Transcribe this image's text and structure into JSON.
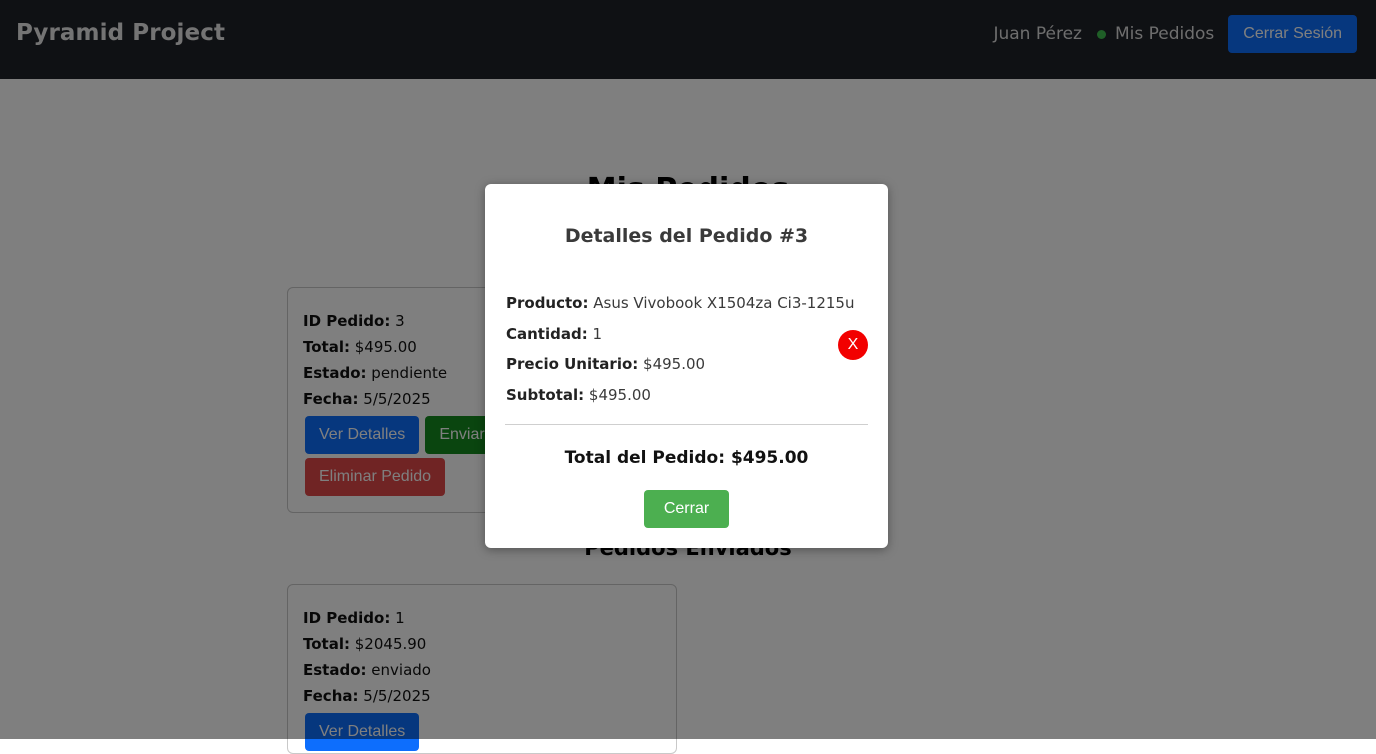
{
  "navbar": {
    "brand": "Pyramid Project",
    "user_name": "Juan Pérez",
    "nav_link": "Mis Pedidos",
    "logout_label": "Cerrar Sesión"
  },
  "page": {
    "title": "Mis Pedidos",
    "sent_section_title": "Pedidos Enviados"
  },
  "pending_order": {
    "id_label": "ID Pedido:",
    "id": "3",
    "total_label": "Total:",
    "total": "$495.00",
    "estado_label": "Estado:",
    "estado": "pendiente",
    "fecha_label": "Fecha:",
    "fecha": "5/5/2025",
    "btn_details": "Ver Detalles",
    "btn_send": "Enviar Pedido",
    "btn_delete": "Eliminar Pedido"
  },
  "sent_order": {
    "id_label": "ID Pedido:",
    "id": "1",
    "total_label": "Total:",
    "total": "$2045.90",
    "estado_label": "Estado:",
    "estado": "enviado",
    "fecha_label": "Fecha:",
    "fecha": "5/5/2025",
    "btn_details": "Ver Detalles"
  },
  "modal": {
    "title": "Detalles del Pedido #3",
    "producto_label": "Producto:",
    "producto": "Asus Vivobook X1504za Ci3-1215u",
    "cantidad_label": "Cantidad:",
    "cantidad": "1",
    "precio_label": "Precio Unitario:",
    "precio": "$495.00",
    "subtotal_label": "Subtotal:",
    "subtotal": "$495.00",
    "remove_label": "X",
    "total": "Total del Pedido: $495.00",
    "close_label": "Cerrar"
  },
  "colors": {
    "navbar_bg": "#1f2228",
    "primary": "#0d6efd",
    "success": "#158a1f",
    "danger": "#e04848",
    "modal_close_button": "#4caf50",
    "remove_icon": "#f20000",
    "status_dot": "#3fbf4f"
  }
}
